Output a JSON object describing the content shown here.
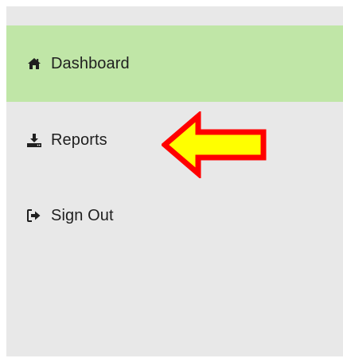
{
  "sidebar": {
    "items": [
      {
        "label": "Dashboard",
        "icon": "home-icon",
        "active": true
      },
      {
        "label": "Reports",
        "icon": "download-icon",
        "active": false
      },
      {
        "label": "Sign Out",
        "icon": "sign-out-icon",
        "active": false
      }
    ]
  },
  "annotation": {
    "arrow_icon": "pointer-arrow-icon",
    "arrow_fill": "#ffff00",
    "arrow_stroke": "#ff0000"
  },
  "colors": {
    "sidebar_bg": "#e8e8e8",
    "active_bg": "#c0e6a7",
    "text": "#1f1f1f"
  }
}
